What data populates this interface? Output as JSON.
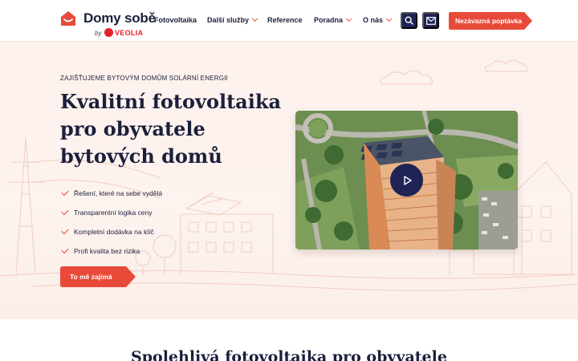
{
  "brand": {
    "name": "Domy sobě",
    "by": "by",
    "partner": "VEOLIA",
    "accent": "#e84a3a",
    "navy": "#1f2355"
  },
  "nav": {
    "items": [
      {
        "label": "Fotovoltaika",
        "dropdown": false
      },
      {
        "label": "Další služby",
        "dropdown": true
      },
      {
        "label": "Reference",
        "dropdown": false
      },
      {
        "label": "Poradna",
        "dropdown": true
      },
      {
        "label": "O nás",
        "dropdown": true
      }
    ],
    "search_icon": "search-icon",
    "mail_icon": "mail-icon",
    "cta_label": "Nezávazná poptávka"
  },
  "hero": {
    "eyebrow": "ZAJIŠŤUJEME BYTOVÝM DOMŮM SOLÁRNÍ ENERGII",
    "headline": [
      "Kvalitní fotovoltaika",
      "pro obyvatele",
      "bytových domů"
    ],
    "features": [
      "Řešení, které na sebe vydělá",
      "Transparentní logika ceny",
      "Kompletní dodávka na klíč",
      "Profi kvalita bez rizika"
    ],
    "cta_label": "To mě zajímá",
    "video_icon": "play-icon"
  },
  "section": {
    "title": "Spolehlivá fotovoltaika pro obyvatele"
  }
}
